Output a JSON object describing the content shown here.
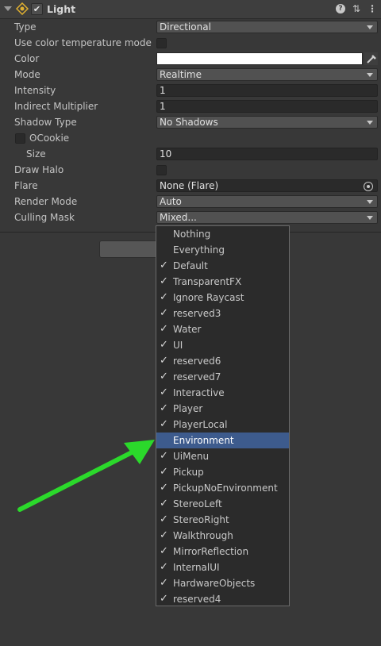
{
  "component": {
    "title": "Light",
    "enabled_check": "✔",
    "help_glyph": "?",
    "presets_glyph": "⇅",
    "more_glyph": "⋮"
  },
  "props": {
    "type": {
      "label": "Type",
      "value": "Directional"
    },
    "color_temp": {
      "label": "Use color temperature mode"
    },
    "color": {
      "label": "Color",
      "value": "#ffffff"
    },
    "mode": {
      "label": "Mode",
      "value": "Realtime"
    },
    "intensity": {
      "label": "Intensity",
      "value": "1"
    },
    "indirect": {
      "label": "Indirect Multiplier",
      "value": "1"
    },
    "shadow": {
      "label": "Shadow Type",
      "value": "No Shadows"
    },
    "cookie": {
      "label": "Cookie",
      "icon": "ʘ"
    },
    "size": {
      "label": "Size",
      "value": "10"
    },
    "halo": {
      "label": "Draw Halo"
    },
    "flare": {
      "label": "Flare",
      "value": "None (Flare)"
    },
    "render": {
      "label": "Render Mode",
      "value": "Auto"
    },
    "culling": {
      "label": "Culling Mask",
      "value": "Mixed..."
    }
  },
  "menu": {
    "items": [
      {
        "label": "Nothing",
        "checked": false
      },
      {
        "label": "Everything",
        "checked": false
      },
      {
        "label": "Default",
        "checked": true
      },
      {
        "label": "TransparentFX",
        "checked": true
      },
      {
        "label": "Ignore Raycast",
        "checked": true
      },
      {
        "label": "reserved3",
        "checked": true
      },
      {
        "label": "Water",
        "checked": true
      },
      {
        "label": "UI",
        "checked": true
      },
      {
        "label": "reserved6",
        "checked": true
      },
      {
        "label": "reserved7",
        "checked": true
      },
      {
        "label": "Interactive",
        "checked": true
      },
      {
        "label": "Player",
        "checked": true
      },
      {
        "label": "PlayerLocal",
        "checked": true
      },
      {
        "label": "Environment",
        "checked": false,
        "highlighted": true
      },
      {
        "label": "UiMenu",
        "checked": true
      },
      {
        "label": "Pickup",
        "checked": true
      },
      {
        "label": "PickupNoEnvironment",
        "checked": true
      },
      {
        "label": "StereoLeft",
        "checked": true
      },
      {
        "label": "StereoRight",
        "checked": true
      },
      {
        "label": "Walkthrough",
        "checked": true
      },
      {
        "label": "MirrorReflection",
        "checked": true
      },
      {
        "label": "InternalUI",
        "checked": true
      },
      {
        "label": "HardwareObjects",
        "checked": true
      },
      {
        "label": "reserved4",
        "checked": true
      }
    ]
  },
  "colors": {
    "highlight": "#3d5b8d",
    "annotation_arrow": "#2bd92b"
  }
}
